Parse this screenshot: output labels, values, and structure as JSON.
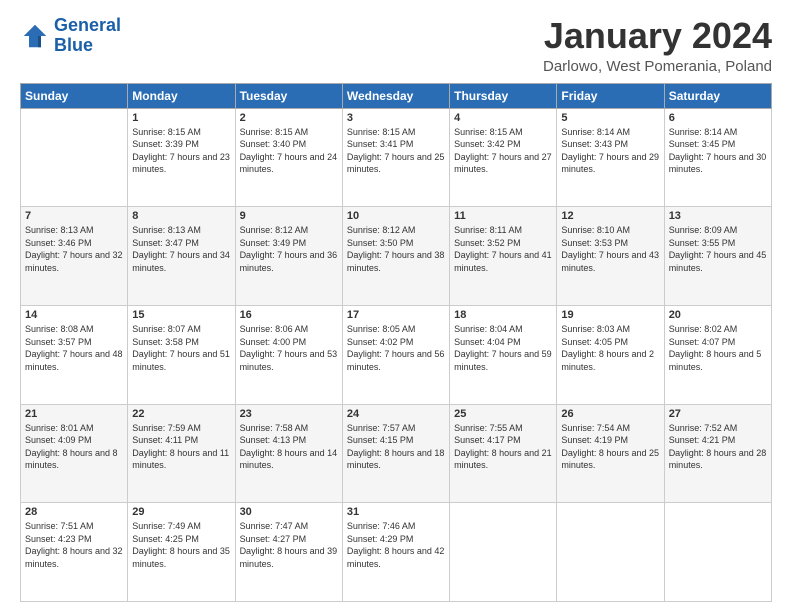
{
  "header": {
    "logo_line1": "General",
    "logo_line2": "Blue",
    "month_title": "January 2024",
    "location": "Darlowo, West Pomerania, Poland"
  },
  "weekdays": [
    "Sunday",
    "Monday",
    "Tuesday",
    "Wednesday",
    "Thursday",
    "Friday",
    "Saturday"
  ],
  "weeks": [
    [
      {
        "day": "",
        "sunrise": "",
        "sunset": "",
        "daylight": ""
      },
      {
        "day": "1",
        "sunrise": "Sunrise: 8:15 AM",
        "sunset": "Sunset: 3:39 PM",
        "daylight": "Daylight: 7 hours and 23 minutes."
      },
      {
        "day": "2",
        "sunrise": "Sunrise: 8:15 AM",
        "sunset": "Sunset: 3:40 PM",
        "daylight": "Daylight: 7 hours and 24 minutes."
      },
      {
        "day": "3",
        "sunrise": "Sunrise: 8:15 AM",
        "sunset": "Sunset: 3:41 PM",
        "daylight": "Daylight: 7 hours and 25 minutes."
      },
      {
        "day": "4",
        "sunrise": "Sunrise: 8:15 AM",
        "sunset": "Sunset: 3:42 PM",
        "daylight": "Daylight: 7 hours and 27 minutes."
      },
      {
        "day": "5",
        "sunrise": "Sunrise: 8:14 AM",
        "sunset": "Sunset: 3:43 PM",
        "daylight": "Daylight: 7 hours and 29 minutes."
      },
      {
        "day": "6",
        "sunrise": "Sunrise: 8:14 AM",
        "sunset": "Sunset: 3:45 PM",
        "daylight": "Daylight: 7 hours and 30 minutes."
      }
    ],
    [
      {
        "day": "7",
        "sunrise": "Sunrise: 8:13 AM",
        "sunset": "Sunset: 3:46 PM",
        "daylight": "Daylight: 7 hours and 32 minutes."
      },
      {
        "day": "8",
        "sunrise": "Sunrise: 8:13 AM",
        "sunset": "Sunset: 3:47 PM",
        "daylight": "Daylight: 7 hours and 34 minutes."
      },
      {
        "day": "9",
        "sunrise": "Sunrise: 8:12 AM",
        "sunset": "Sunset: 3:49 PM",
        "daylight": "Daylight: 7 hours and 36 minutes."
      },
      {
        "day": "10",
        "sunrise": "Sunrise: 8:12 AM",
        "sunset": "Sunset: 3:50 PM",
        "daylight": "Daylight: 7 hours and 38 minutes."
      },
      {
        "day": "11",
        "sunrise": "Sunrise: 8:11 AM",
        "sunset": "Sunset: 3:52 PM",
        "daylight": "Daylight: 7 hours and 41 minutes."
      },
      {
        "day": "12",
        "sunrise": "Sunrise: 8:10 AM",
        "sunset": "Sunset: 3:53 PM",
        "daylight": "Daylight: 7 hours and 43 minutes."
      },
      {
        "day": "13",
        "sunrise": "Sunrise: 8:09 AM",
        "sunset": "Sunset: 3:55 PM",
        "daylight": "Daylight: 7 hours and 45 minutes."
      }
    ],
    [
      {
        "day": "14",
        "sunrise": "Sunrise: 8:08 AM",
        "sunset": "Sunset: 3:57 PM",
        "daylight": "Daylight: 7 hours and 48 minutes."
      },
      {
        "day": "15",
        "sunrise": "Sunrise: 8:07 AM",
        "sunset": "Sunset: 3:58 PM",
        "daylight": "Daylight: 7 hours and 51 minutes."
      },
      {
        "day": "16",
        "sunrise": "Sunrise: 8:06 AM",
        "sunset": "Sunset: 4:00 PM",
        "daylight": "Daylight: 7 hours and 53 minutes."
      },
      {
        "day": "17",
        "sunrise": "Sunrise: 8:05 AM",
        "sunset": "Sunset: 4:02 PM",
        "daylight": "Daylight: 7 hours and 56 minutes."
      },
      {
        "day": "18",
        "sunrise": "Sunrise: 8:04 AM",
        "sunset": "Sunset: 4:04 PM",
        "daylight": "Daylight: 7 hours and 59 minutes."
      },
      {
        "day": "19",
        "sunrise": "Sunrise: 8:03 AM",
        "sunset": "Sunset: 4:05 PM",
        "daylight": "Daylight: 8 hours and 2 minutes."
      },
      {
        "day": "20",
        "sunrise": "Sunrise: 8:02 AM",
        "sunset": "Sunset: 4:07 PM",
        "daylight": "Daylight: 8 hours and 5 minutes."
      }
    ],
    [
      {
        "day": "21",
        "sunrise": "Sunrise: 8:01 AM",
        "sunset": "Sunset: 4:09 PM",
        "daylight": "Daylight: 8 hours and 8 minutes."
      },
      {
        "day": "22",
        "sunrise": "Sunrise: 7:59 AM",
        "sunset": "Sunset: 4:11 PM",
        "daylight": "Daylight: 8 hours and 11 minutes."
      },
      {
        "day": "23",
        "sunrise": "Sunrise: 7:58 AM",
        "sunset": "Sunset: 4:13 PM",
        "daylight": "Daylight: 8 hours and 14 minutes."
      },
      {
        "day": "24",
        "sunrise": "Sunrise: 7:57 AM",
        "sunset": "Sunset: 4:15 PM",
        "daylight": "Daylight: 8 hours and 18 minutes."
      },
      {
        "day": "25",
        "sunrise": "Sunrise: 7:55 AM",
        "sunset": "Sunset: 4:17 PM",
        "daylight": "Daylight: 8 hours and 21 minutes."
      },
      {
        "day": "26",
        "sunrise": "Sunrise: 7:54 AM",
        "sunset": "Sunset: 4:19 PM",
        "daylight": "Daylight: 8 hours and 25 minutes."
      },
      {
        "day": "27",
        "sunrise": "Sunrise: 7:52 AM",
        "sunset": "Sunset: 4:21 PM",
        "daylight": "Daylight: 8 hours and 28 minutes."
      }
    ],
    [
      {
        "day": "28",
        "sunrise": "Sunrise: 7:51 AM",
        "sunset": "Sunset: 4:23 PM",
        "daylight": "Daylight: 8 hours and 32 minutes."
      },
      {
        "day": "29",
        "sunrise": "Sunrise: 7:49 AM",
        "sunset": "Sunset: 4:25 PM",
        "daylight": "Daylight: 8 hours and 35 minutes."
      },
      {
        "day": "30",
        "sunrise": "Sunrise: 7:47 AM",
        "sunset": "Sunset: 4:27 PM",
        "daylight": "Daylight: 8 hours and 39 minutes."
      },
      {
        "day": "31",
        "sunrise": "Sunrise: 7:46 AM",
        "sunset": "Sunset: 4:29 PM",
        "daylight": "Daylight: 8 hours and 42 minutes."
      },
      {
        "day": "",
        "sunrise": "",
        "sunset": "",
        "daylight": ""
      },
      {
        "day": "",
        "sunrise": "",
        "sunset": "",
        "daylight": ""
      },
      {
        "day": "",
        "sunrise": "",
        "sunset": "",
        "daylight": ""
      }
    ]
  ]
}
